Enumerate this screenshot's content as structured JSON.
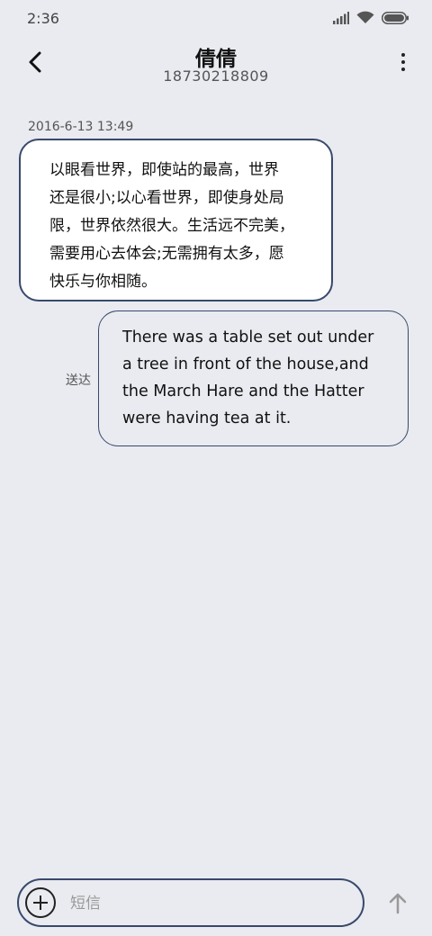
{
  "status_bar": {
    "time": "2:36"
  },
  "header": {
    "contact_name": "倩倩",
    "phone_number": "18730218809"
  },
  "conversation": {
    "timestamp": "2016-6-13 13:49",
    "incoming_message": {
      "lines": [
        "以眼看世界，即使站的最高，世界",
        "还是很小;以心看世界，即使身处局",
        "限，世界依然很大。生活远不完美，",
        "需要用心去体会;无需拥有太多，愿",
        "快乐与你相随。"
      ]
    },
    "outgoing_message": {
      "lines": [
        "There was a table set out under",
        "a tree in front of the house,and",
        "the March Hare and the Hatter",
        "were having tea at it."
      ],
      "status": "送达"
    }
  },
  "composer": {
    "placeholder": "短信"
  },
  "colors": {
    "background": "#e9ebf0",
    "bubble_border": "#38496b",
    "incoming_bg": "#ffffff"
  },
  "icons": [
    "signal-icon",
    "wifi-icon",
    "battery-icon",
    "back-arrow-icon",
    "more-options-icon",
    "add-icon",
    "send-icon"
  ]
}
